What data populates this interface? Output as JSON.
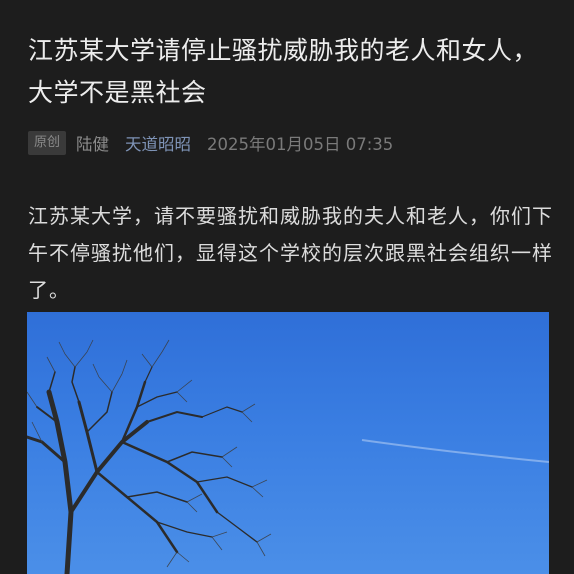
{
  "article": {
    "title": "江苏某大学请停止骚扰威胁我的老人和女人，大学不是黑社会",
    "meta": {
      "badge": "原创",
      "author": "陆健",
      "account": "天道昭昭",
      "date": "2025年01月05日 07:35"
    },
    "body": "江苏某大学，请不要骚扰和威胁我的夫人和老人，你们下午不停骚扰他们，显得这个学校的层次跟黑社会组织一样了。"
  },
  "colors": {
    "background": "#1d1d1d",
    "account_link": "#7e93b6",
    "sky": "#3a7ee2"
  }
}
